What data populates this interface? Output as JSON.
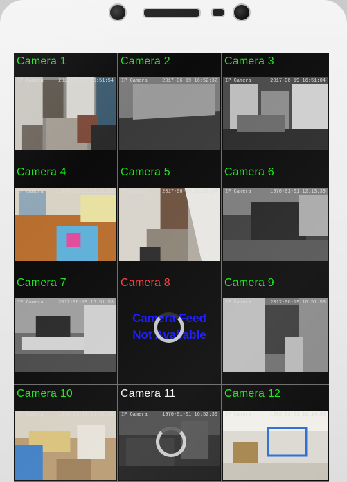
{
  "cameras": [
    {
      "label": "Camera 1",
      "status": "live",
      "overlay_name": "IP Camera",
      "overlay_time": "2017-06-19 16:51:54"
    },
    {
      "label": "Camera 2",
      "status": "live",
      "overlay_name": "IP Camera",
      "overlay_time": "2017-06-19 16:52:32"
    },
    {
      "label": "Camera 3",
      "status": "live",
      "overlay_name": "IP Camera",
      "overlay_time": "2017-06-19 16:51:04"
    },
    {
      "label": "Camera 4",
      "status": "live",
      "overlay_name": "IP Camera",
      "overlay_time": "1970-01-01 16:51:02"
    },
    {
      "label": "Camera 5",
      "status": "live",
      "overlay_name": "IP Camera",
      "overlay_time": "2017-06-19 16:50:54"
    },
    {
      "label": "Camera 6",
      "status": "live",
      "overlay_name": "IP Camera",
      "overlay_time": "1970-01-01 12:13:39"
    },
    {
      "label": "Camera 7",
      "status": "live",
      "overlay_name": "IP Camera",
      "overlay_time": "2017-06-19 16:51:53"
    },
    {
      "label": "Camera 8",
      "status": "error",
      "error_text": "Camera Feed Not Available",
      "label_color": "#ff3b3b"
    },
    {
      "label": "Camera 9",
      "status": "live",
      "overlay_name": "IP Camera",
      "overlay_time": "2017-06-19 16:51:58"
    },
    {
      "label": "Camera 10",
      "status": "live",
      "overlay_name": "IP Camera",
      "overlay_time": "1970-01-01 16:51:58"
    },
    {
      "label": "Camera 11",
      "status": "loading",
      "overlay_name": "IP Camera",
      "overlay_time": "1970-01-01 16:52:30",
      "label_color": "#f2f2f2"
    },
    {
      "label": "Camera 12",
      "status": "live",
      "overlay_name": "IP Camera",
      "overlay_time": "1970-01-01 16:14:40"
    }
  ],
  "colors": {
    "label_default": "#19e619",
    "label_error": "#ff3b3b",
    "label_selected": "#f2f2f2",
    "error_text": "#1515ff"
  }
}
